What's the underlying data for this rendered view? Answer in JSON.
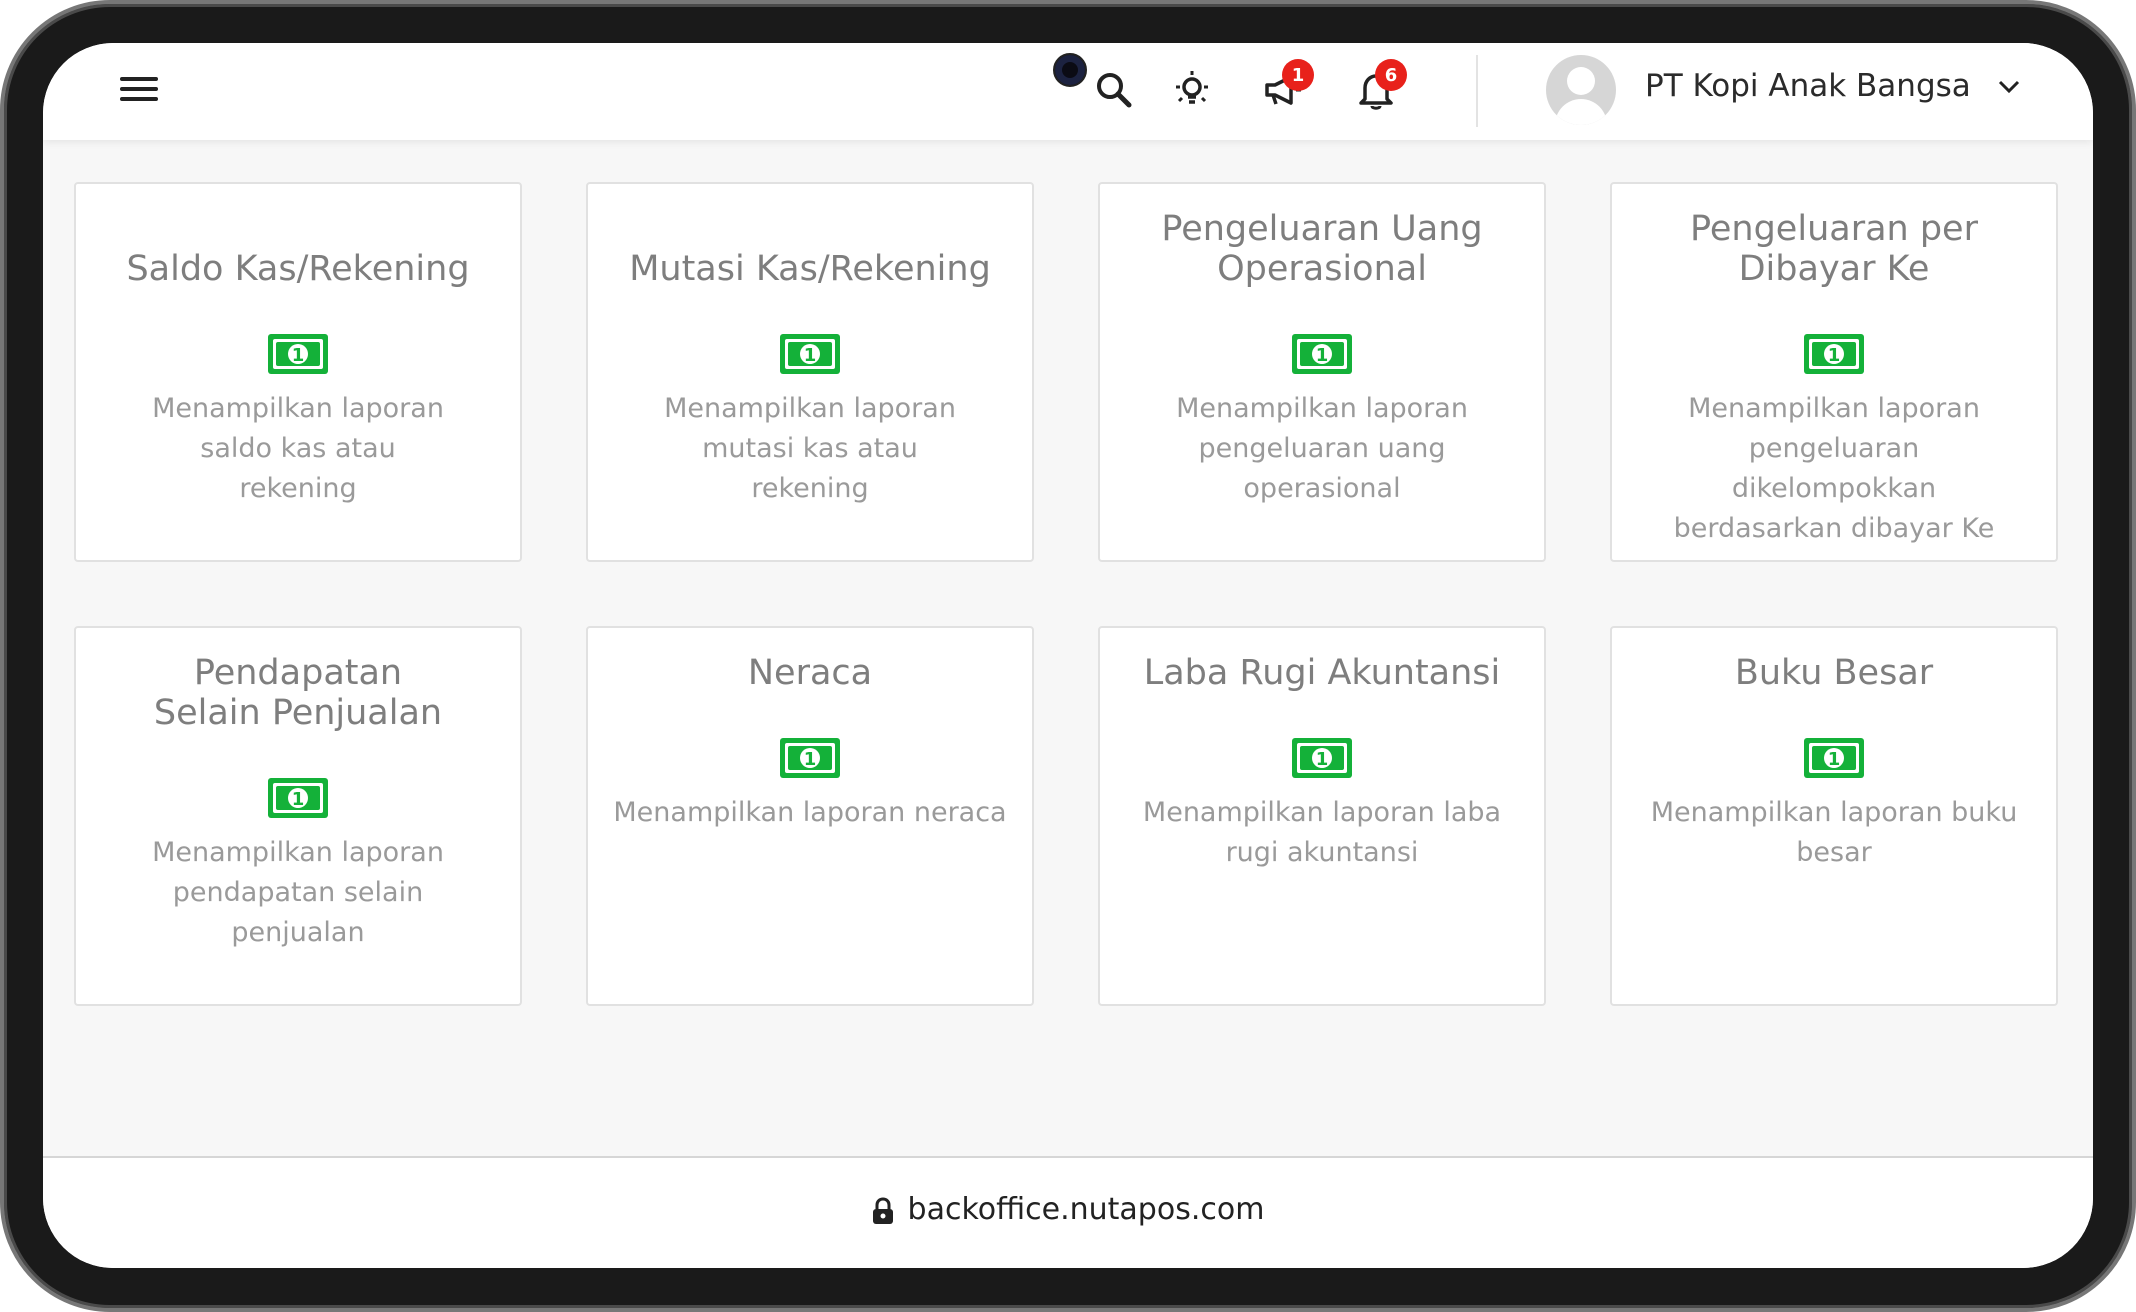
{
  "header": {
    "menu_icon": "hamburger-menu-icon",
    "search_icon": "search-icon",
    "theme_icon": "light-bulb-icon",
    "announcement_icon": "megaphone-icon",
    "announcement_badge": "1",
    "notification_icon": "bell-icon",
    "notification_badge": "6",
    "user_name": "PT Kopi Anak Bangsa",
    "user_menu_icon": "chevron-down-icon"
  },
  "colors": {
    "accent_green": "#14b139",
    "badge_red": "#e8211b"
  },
  "reports": [
    {
      "title": "Saldo Kas/Rekening",
      "icon": "money-bill-icon",
      "description": "Menampilkan laporan saldo kas atau rekening"
    },
    {
      "title": "Mutasi Kas/Rekening",
      "icon": "money-bill-icon",
      "description": "Menampilkan laporan mutasi kas atau rekening"
    },
    {
      "title": "Pengeluaran Uang Operasional",
      "icon": "money-bill-icon",
      "description": "Menampilkan laporan pengeluaran uang operasional"
    },
    {
      "title": "Pengeluaran per Dibayar Ke",
      "icon": "money-bill-icon",
      "description": "Menampilkan laporan pengeluaran dikelompokkan berdasarkan dibayar Ke"
    },
    {
      "title": "Pendapatan Selain Penjualan",
      "icon": "money-bill-icon",
      "description": "Menampilkan laporan pendapatan selain penjualan"
    },
    {
      "title": "Neraca",
      "icon": "money-bill-icon",
      "description": "Menampilkan laporan neraca"
    },
    {
      "title": "Laba Rugi Akuntansi",
      "icon": "money-bill-icon",
      "description": "Menampilkan laporan laba rugi akuntansi"
    },
    {
      "title": "Buku Besar",
      "icon": "money-bill-icon",
      "description": "Menampilkan laporan buku besar"
    }
  ],
  "browser": {
    "lock_icon": "lock-icon",
    "url": "backoffice.nutapos.com"
  }
}
